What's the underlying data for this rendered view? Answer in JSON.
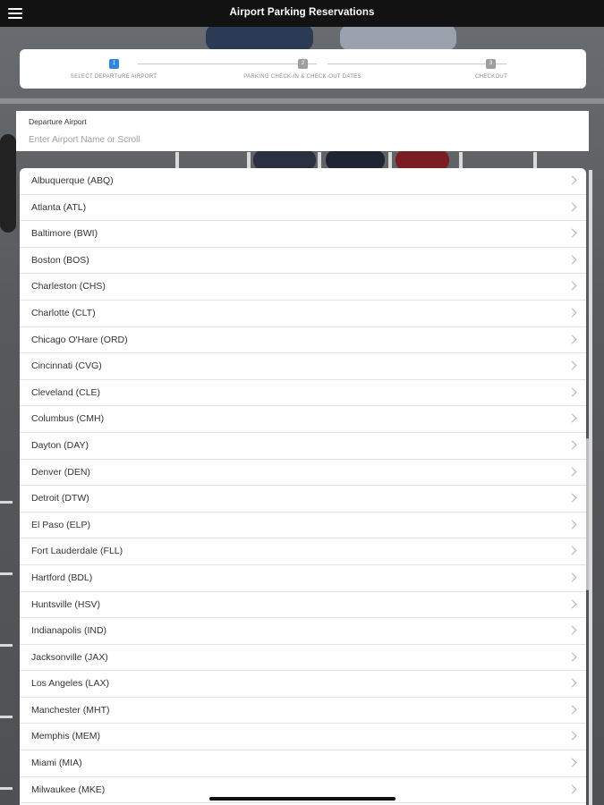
{
  "app_bar": {
    "title": "Airport Parking Reservations",
    "menu_icon": "menu-icon"
  },
  "stepper": {
    "steps": [
      {
        "number": "1",
        "label": "SELECT DEPARTURE AIRPORT",
        "active": true
      },
      {
        "number": "2",
        "label": "PARKING CHECK-IN & CHECK-OUT DATES",
        "active": false
      },
      {
        "number": "3",
        "label": "CHECKOUT",
        "active": false
      }
    ],
    "colors": {
      "active": "#2e86de",
      "inactive": "#9e9e9e"
    }
  },
  "search": {
    "label": "Departure Airport",
    "placeholder": "Enter Airport Name or Scroll",
    "value": ""
  },
  "airports": [
    "Albuquerque (ABQ)",
    "Atlanta (ATL)",
    "Baltimore (BWI)",
    "Boston (BOS)",
    "Charleston (CHS)",
    "Charlotte (CLT)",
    "Chicago O'Hare (ORD)",
    "Cincinnati (CVG)",
    "Cleveland (CLE)",
    "Columbus (CMH)",
    "Dayton (DAY)",
    "Denver (DEN)",
    "Detroit (DTW)",
    "El Paso (ELP)",
    "Fort Lauderdale (FLL)",
    "Hartford (BDL)",
    "Huntsville (HSV)",
    "Indianapolis (IND)",
    "Jacksonville (JAX)",
    "Los Angeles (LAX)",
    "Manchester (MHT)",
    "Memphis (MEM)",
    "Miami (MIA)",
    "Milwaukee (MKE)"
  ]
}
